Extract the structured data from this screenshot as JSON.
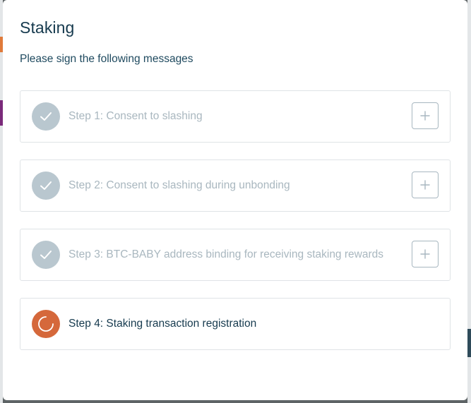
{
  "modal": {
    "title": "Staking",
    "subtitle": "Please sign the following messages"
  },
  "steps": [
    {
      "label": "Step 1: Consent to slashing",
      "status": "completed",
      "icon": "check-icon",
      "action_icon": "plus-icon"
    },
    {
      "label": "Step 2: Consent to slashing during unbonding",
      "status": "completed",
      "icon": "check-icon",
      "action_icon": "plus-icon"
    },
    {
      "label": "Step 3: BTC-BABY address binding for receiving staking rewards",
      "status": "completed",
      "icon": "check-icon",
      "action_icon": "plus-icon"
    },
    {
      "label": "Step 4: Staking transaction registration",
      "status": "in-progress",
      "icon": "spinner-icon"
    }
  ],
  "colors": {
    "title": "#163a4e",
    "completed_icon_bg": "#b9c7cf",
    "completed_text": "#a9b7bf",
    "active_icon_bg": "#d5683b",
    "border": "#dfe3e6"
  }
}
